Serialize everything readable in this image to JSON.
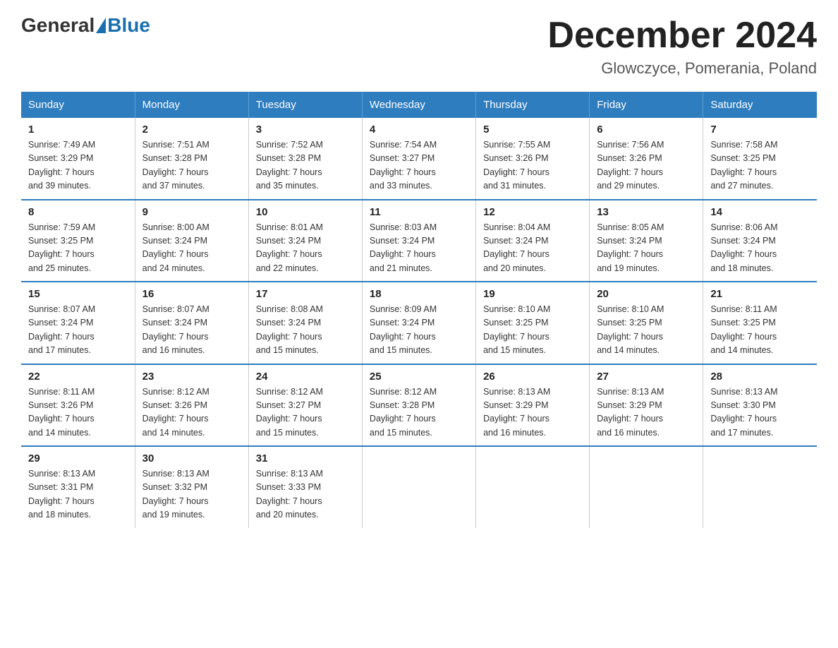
{
  "header": {
    "logo": {
      "general": "General",
      "blue": "Blue"
    },
    "title": "December 2024",
    "subtitle": "Glowczyce, Pomerania, Poland"
  },
  "days_of_week": [
    "Sunday",
    "Monday",
    "Tuesday",
    "Wednesday",
    "Thursday",
    "Friday",
    "Saturday"
  ],
  "weeks": [
    [
      {
        "day": "1",
        "sunrise": "7:49 AM",
        "sunset": "3:29 PM",
        "daylight": "7 hours and 39 minutes."
      },
      {
        "day": "2",
        "sunrise": "7:51 AM",
        "sunset": "3:28 PM",
        "daylight": "7 hours and 37 minutes."
      },
      {
        "day": "3",
        "sunrise": "7:52 AM",
        "sunset": "3:28 PM",
        "daylight": "7 hours and 35 minutes."
      },
      {
        "day": "4",
        "sunrise": "7:54 AM",
        "sunset": "3:27 PM",
        "daylight": "7 hours and 33 minutes."
      },
      {
        "day": "5",
        "sunrise": "7:55 AM",
        "sunset": "3:26 PM",
        "daylight": "7 hours and 31 minutes."
      },
      {
        "day": "6",
        "sunrise": "7:56 AM",
        "sunset": "3:26 PM",
        "daylight": "7 hours and 29 minutes."
      },
      {
        "day": "7",
        "sunrise": "7:58 AM",
        "sunset": "3:25 PM",
        "daylight": "7 hours and 27 minutes."
      }
    ],
    [
      {
        "day": "8",
        "sunrise": "7:59 AM",
        "sunset": "3:25 PM",
        "daylight": "7 hours and 25 minutes."
      },
      {
        "day": "9",
        "sunrise": "8:00 AM",
        "sunset": "3:24 PM",
        "daylight": "7 hours and 24 minutes."
      },
      {
        "day": "10",
        "sunrise": "8:01 AM",
        "sunset": "3:24 PM",
        "daylight": "7 hours and 22 minutes."
      },
      {
        "day": "11",
        "sunrise": "8:03 AM",
        "sunset": "3:24 PM",
        "daylight": "7 hours and 21 minutes."
      },
      {
        "day": "12",
        "sunrise": "8:04 AM",
        "sunset": "3:24 PM",
        "daylight": "7 hours and 20 minutes."
      },
      {
        "day": "13",
        "sunrise": "8:05 AM",
        "sunset": "3:24 PM",
        "daylight": "7 hours and 19 minutes."
      },
      {
        "day": "14",
        "sunrise": "8:06 AM",
        "sunset": "3:24 PM",
        "daylight": "7 hours and 18 minutes."
      }
    ],
    [
      {
        "day": "15",
        "sunrise": "8:07 AM",
        "sunset": "3:24 PM",
        "daylight": "7 hours and 17 minutes."
      },
      {
        "day": "16",
        "sunrise": "8:07 AM",
        "sunset": "3:24 PM",
        "daylight": "7 hours and 16 minutes."
      },
      {
        "day": "17",
        "sunrise": "8:08 AM",
        "sunset": "3:24 PM",
        "daylight": "7 hours and 15 minutes."
      },
      {
        "day": "18",
        "sunrise": "8:09 AM",
        "sunset": "3:24 PM",
        "daylight": "7 hours and 15 minutes."
      },
      {
        "day": "19",
        "sunrise": "8:10 AM",
        "sunset": "3:25 PM",
        "daylight": "7 hours and 15 minutes."
      },
      {
        "day": "20",
        "sunrise": "8:10 AM",
        "sunset": "3:25 PM",
        "daylight": "7 hours and 14 minutes."
      },
      {
        "day": "21",
        "sunrise": "8:11 AM",
        "sunset": "3:25 PM",
        "daylight": "7 hours and 14 minutes."
      }
    ],
    [
      {
        "day": "22",
        "sunrise": "8:11 AM",
        "sunset": "3:26 PM",
        "daylight": "7 hours and 14 minutes."
      },
      {
        "day": "23",
        "sunrise": "8:12 AM",
        "sunset": "3:26 PM",
        "daylight": "7 hours and 14 minutes."
      },
      {
        "day": "24",
        "sunrise": "8:12 AM",
        "sunset": "3:27 PM",
        "daylight": "7 hours and 15 minutes."
      },
      {
        "day": "25",
        "sunrise": "8:12 AM",
        "sunset": "3:28 PM",
        "daylight": "7 hours and 15 minutes."
      },
      {
        "day": "26",
        "sunrise": "8:13 AM",
        "sunset": "3:29 PM",
        "daylight": "7 hours and 16 minutes."
      },
      {
        "day": "27",
        "sunrise": "8:13 AM",
        "sunset": "3:29 PM",
        "daylight": "7 hours and 16 minutes."
      },
      {
        "day": "28",
        "sunrise": "8:13 AM",
        "sunset": "3:30 PM",
        "daylight": "7 hours and 17 minutes."
      }
    ],
    [
      {
        "day": "29",
        "sunrise": "8:13 AM",
        "sunset": "3:31 PM",
        "daylight": "7 hours and 18 minutes."
      },
      {
        "day": "30",
        "sunrise": "8:13 AM",
        "sunset": "3:32 PM",
        "daylight": "7 hours and 19 minutes."
      },
      {
        "day": "31",
        "sunrise": "8:13 AM",
        "sunset": "3:33 PM",
        "daylight": "7 hours and 20 minutes."
      },
      null,
      null,
      null,
      null
    ]
  ],
  "labels": {
    "sunrise": "Sunrise:",
    "sunset": "Sunset:",
    "daylight": "Daylight:"
  }
}
